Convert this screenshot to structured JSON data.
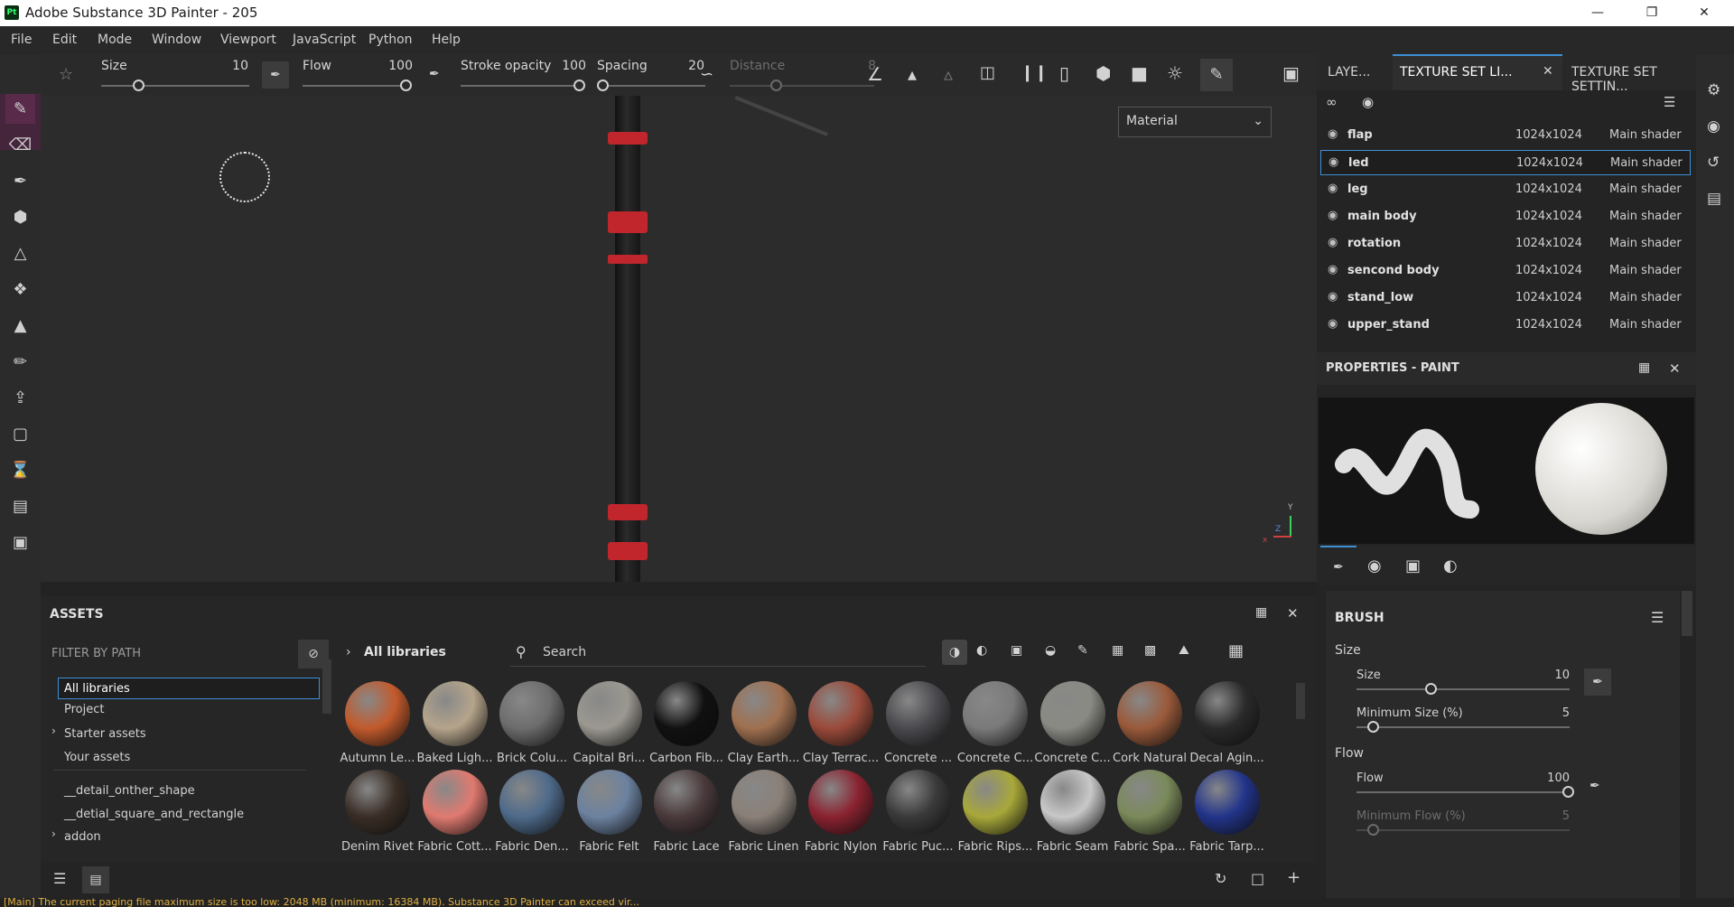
{
  "app": {
    "title": "Adobe Substance 3D Painter - 205",
    "logo": "Pt"
  },
  "menu": [
    "File",
    "Edit",
    "Mode",
    "Window",
    "Viewport",
    "JavaScript",
    "Python",
    "Help"
  ],
  "toolbar": {
    "size_label": "Size",
    "size_value": "10",
    "flow_label": "Flow",
    "flow_value": "100",
    "stroke_opacity_label": "Stroke opacity",
    "stroke_opacity_value": "100",
    "spacing_label": "Spacing",
    "spacing_value": "20",
    "distance_label": "Distance",
    "distance_value": "8"
  },
  "viewport": {
    "channel_select": "Material",
    "axis_y": "Y",
    "axis_z": "Z",
    "axis_x": "x"
  },
  "assets": {
    "title": "ASSETS",
    "filter_label": "FILTER BY PATH",
    "breadcrumb": "All libraries",
    "search_placeholder": "Search",
    "tree": [
      "All libraries",
      "Project",
      "Starter assets",
      "Your assets",
      "__detail_onther_shape",
      "__detial_square_and_rectangle",
      "addon"
    ],
    "row1": [
      {
        "name": "Autumn Le...",
        "color": "#c25a2c"
      },
      {
        "name": "Baked Ligh...",
        "color": "#b5a48b"
      },
      {
        "name": "Brick Colu...",
        "color": "#6d6d6d"
      },
      {
        "name": "Capital Bri...",
        "color": "#9a9890"
      },
      {
        "name": "Carbon Fib...",
        "color": "#101010"
      },
      {
        "name": "Clay Earth...",
        "color": "#a07050"
      },
      {
        "name": "Clay Terrac...",
        "color": "#9a4a3a"
      },
      {
        "name": "Concrete ...",
        "color": "#4a4a4e"
      },
      {
        "name": "Concrete C...",
        "color": "#7a7a7a"
      },
      {
        "name": "Concrete C...",
        "color": "#8a8a84"
      },
      {
        "name": "Cork Natural",
        "color": "#9a5a3a"
      },
      {
        "name": "Decal Agin...",
        "color": "#2a2a2a"
      }
    ],
    "row2": [
      {
        "name": "Denim Rivet",
        "color": "#3a2e26"
      },
      {
        "name": "Fabric Cott...",
        "color": "#e07a70"
      },
      {
        "name": "Fabric Den...",
        "color": "#4e6a8a"
      },
      {
        "name": "Fabric Felt",
        "color": "#6c82a0"
      },
      {
        "name": "Fabric Lace",
        "color": "#4a3a3c"
      },
      {
        "name": "Fabric Linen",
        "color": "#8a8078"
      },
      {
        "name": "Fabric Nylon",
        "color": "#8a2230"
      },
      {
        "name": "Fabric Puc...",
        "color": "#3a3a3a"
      },
      {
        "name": "Fabric Rips...",
        "color": "#a8a83a"
      },
      {
        "name": "Fabric Seam",
        "color": "#c8c8c8"
      },
      {
        "name": "Fabric Spa...",
        "color": "#7a8a5a"
      },
      {
        "name": "Fabric Tarp...",
        "color": "#22348a"
      }
    ]
  },
  "right_tabs": [
    "LAYE...",
    "TEXTURE SET LI...",
    "TEXTURE SET SETTIN..."
  ],
  "texture_sets": [
    {
      "name": "flap",
      "res": "1024x1024",
      "shader": "Main shader"
    },
    {
      "name": "led",
      "res": "1024x1024",
      "shader": "Main shader"
    },
    {
      "name": "leg",
      "res": "1024x1024",
      "shader": "Main shader"
    },
    {
      "name": "main body",
      "res": "1024x1024",
      "shader": "Main shader"
    },
    {
      "name": "rotation",
      "res": "1024x1024",
      "shader": "Main shader"
    },
    {
      "name": "sencond body",
      "res": "1024x1024",
      "shader": "Main shader"
    },
    {
      "name": "stand_low",
      "res": "1024x1024",
      "shader": "Main shader"
    },
    {
      "name": "upper_stand",
      "res": "1024x1024",
      "shader": "Main shader"
    }
  ],
  "properties": {
    "title": "PROPERTIES - PAINT",
    "brush_label": "BRUSH",
    "size_group": "Size",
    "size_label": "Size",
    "size_value": "10",
    "min_size_label": "Minimum Size (%)",
    "min_size_value": "5",
    "flow_group": "Flow",
    "flow_label": "Flow",
    "flow_value": "100",
    "min_flow_label": "Minimum Flow (%)",
    "min_flow_value": "5"
  },
  "status": {
    "message": "[Main] The current paging file maximum size is too low: 2048 MB (minimum: 16384 MB). Substance 3D Painter can exceed vir..."
  },
  "colors": {
    "accent": "#3d8fd6",
    "selection": "#5a2a4a",
    "warning": "#e0b040",
    "red_band": "#c0262c"
  }
}
